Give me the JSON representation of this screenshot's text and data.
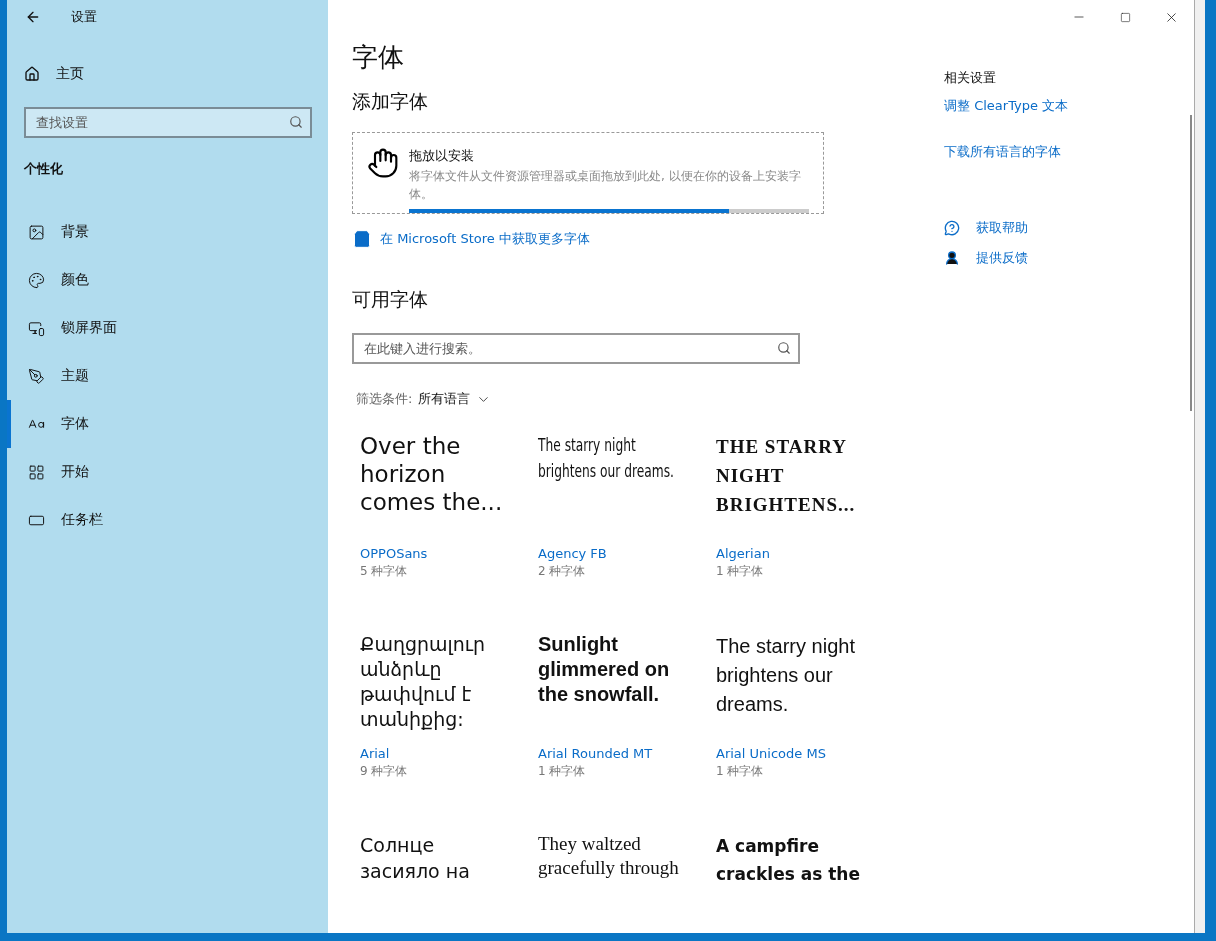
{
  "window": {
    "title": "设置"
  },
  "sidebar": {
    "home": "主页",
    "search": {
      "placeholder": "查找设置"
    },
    "section": "个性化",
    "items": [
      {
        "label": "背景",
        "selected": false
      },
      {
        "label": "颜色",
        "selected": false
      },
      {
        "label": "锁屏界面",
        "selected": false
      },
      {
        "label": "主题",
        "selected": false
      },
      {
        "label": "字体",
        "selected": true
      },
      {
        "label": "开始",
        "selected": false
      },
      {
        "label": "任务栏",
        "selected": false
      }
    ]
  },
  "page": {
    "title": "字体",
    "add_heading": "添加字体",
    "drop": {
      "title": "拖放以安装",
      "description": "将字体文件从文件资源管理器或桌面拖放到此处, 以便在你的设备上安装字体。",
      "level": 0.8
    },
    "store_link": "在 Microsoft Store 中获取更多字体",
    "available_heading": "可用字体",
    "search": {
      "placeholder": "在此键入进行搜索。"
    },
    "filter": {
      "label": "筛选条件:",
      "value": "所有语言"
    },
    "fonts": [
      {
        "sample": "Over the horizon comes the...",
        "name": "OPPOSans",
        "count": "5 种字体"
      },
      {
        "sample": "The starry night brightens our dreams.",
        "name": "Agency FB",
        "count": "2 种字体"
      },
      {
        "sample": "THE STARRY NIGHT BRIGHTENS...",
        "name": "Algerian",
        "count": "1 种字体"
      },
      {
        "sample": "Քաղցրալուր անձրևը թափվում է տանիքից:",
        "name": "Arial",
        "count": "9 种字体"
      },
      {
        "sample": "Sunlight glimmered on the snowfall.",
        "name": "Arial Rounded MT",
        "count": "1 种字体"
      },
      {
        "sample": "The starry night brightens our dreams.",
        "name": "Arial Unicode MS",
        "count": "1 种字体"
      },
      {
        "sample": "Солнце засияло на"
      },
      {
        "sample": "They waltzed gracefully through"
      },
      {
        "sample": "A campfire crackles as the"
      }
    ]
  },
  "related": {
    "heading": "相关设置",
    "links": [
      "调整 ClearType 文本",
      "下载所有语言的字体"
    ],
    "help": [
      "获取帮助",
      "提供反馈"
    ]
  }
}
